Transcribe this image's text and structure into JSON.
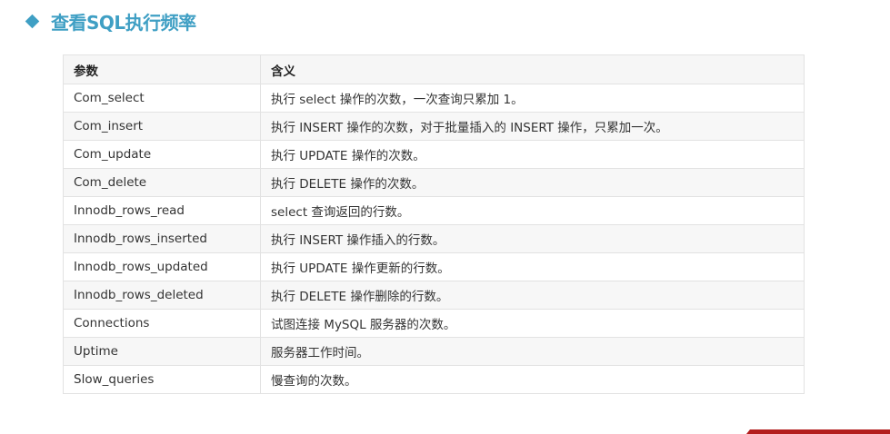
{
  "heading": {
    "title": "查看SQL执行频率",
    "icon": "diamond-bullet-icon",
    "color": "#3f9fc4"
  },
  "table": {
    "headers": [
      "参数",
      "含义"
    ],
    "rows": [
      [
        "Com_select",
        "执行 select 操作的次数，一次查询只累加 1。"
      ],
      [
        "Com_insert",
        "执行 INSERT 操作的次数，对于批量插入的 INSERT 操作，只累加一次。"
      ],
      [
        "Com_update",
        "执行 UPDATE 操作的次数。"
      ],
      [
        "Com_delete",
        "执行 DELETE 操作的次数。"
      ],
      [
        "Innodb_rows_read",
        "select 查询返回的行数。"
      ],
      [
        "Innodb_rows_inserted",
        "执行 INSERT 操作插入的行数。"
      ],
      [
        "Innodb_rows_updated",
        "执行 UPDATE 操作更新的行数。"
      ],
      [
        "Innodb_rows_deleted",
        "执行 DELETE 操作删除的行数。"
      ],
      [
        "Connections",
        "试图连接 MySQL 服务器的次数。"
      ],
      [
        "Uptime",
        "服务器工作时间。"
      ],
      [
        "Slow_queries",
        "慢查询的次数。"
      ]
    ]
  },
  "footer_band": {
    "color": "#b41e1e"
  }
}
